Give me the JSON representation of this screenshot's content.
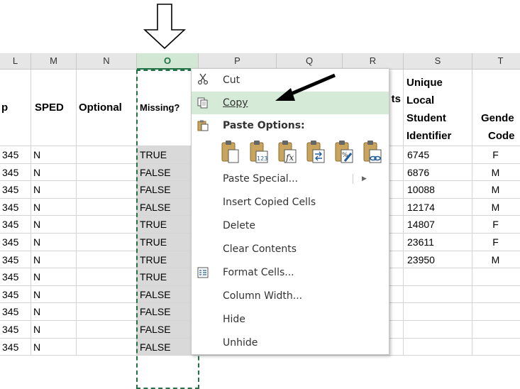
{
  "columns": [
    "L",
    "M",
    "N",
    "O",
    "P",
    "Q",
    "R",
    "S",
    "T"
  ],
  "selected_column": "O",
  "header_row": {
    "L": "p",
    "M": "SPED",
    "N": "Optional",
    "O": "Missing?",
    "R": "ts",
    "S": [
      "Unique",
      "Local",
      "Student",
      "Identifier"
    ],
    "T": [
      "Gende",
      "Code"
    ]
  },
  "rows": [
    {
      "L": "345",
      "M": "N",
      "O": "TRUE",
      "S": "6745",
      "T": "F"
    },
    {
      "L": "345",
      "M": "N",
      "O": "FALSE",
      "S": "6876",
      "T": "M"
    },
    {
      "L": "345",
      "M": "N",
      "O": "FALSE",
      "S": "10088",
      "T": "M"
    },
    {
      "L": "345",
      "M": "N",
      "O": "FALSE",
      "S": "12174",
      "T": "M"
    },
    {
      "L": "345",
      "M": "N",
      "O": "TRUE",
      "S": "14807",
      "T": "F"
    },
    {
      "L": "345",
      "M": "N",
      "O": "TRUE",
      "S": "23611",
      "T": "F"
    },
    {
      "L": "345",
      "M": "N",
      "O": "TRUE",
      "S": "23950",
      "T": "M"
    },
    {
      "L": "345",
      "M": "N",
      "O": "TRUE",
      "S": "",
      "T": ""
    },
    {
      "L": "345",
      "M": "N",
      "O": "FALSE",
      "S": "",
      "T": ""
    },
    {
      "L": "345",
      "M": "N",
      "O": "FALSE",
      "S": "",
      "T": ""
    },
    {
      "L": "345",
      "M": "N",
      "O": "FALSE",
      "S": "",
      "T": ""
    },
    {
      "L": "345",
      "M": "N",
      "O": "FALSE",
      "S": "",
      "T": ""
    }
  ],
  "context_menu": {
    "cut": "Cut",
    "copy": "Copy",
    "paste_options": "Paste Options:",
    "paste_icons": [
      "paste-icon",
      "paste-values-icon",
      "paste-formulas-icon",
      "paste-transpose-icon",
      "paste-formatting-icon",
      "paste-link-icon"
    ],
    "paste_special": "Paste Special...",
    "insert_copied_cells": "Insert Copied Cells",
    "delete": "Delete",
    "clear_contents": "Clear Contents",
    "format_cells": "Format Cells...",
    "column_width": "Column Width...",
    "hide": "Hide",
    "unhide": "Unhide",
    "highlighted": "copy"
  },
  "colors": {
    "selection_green": "#217346",
    "highlight": "#d5ebd8",
    "selected_fill": "#d9d9d9"
  }
}
